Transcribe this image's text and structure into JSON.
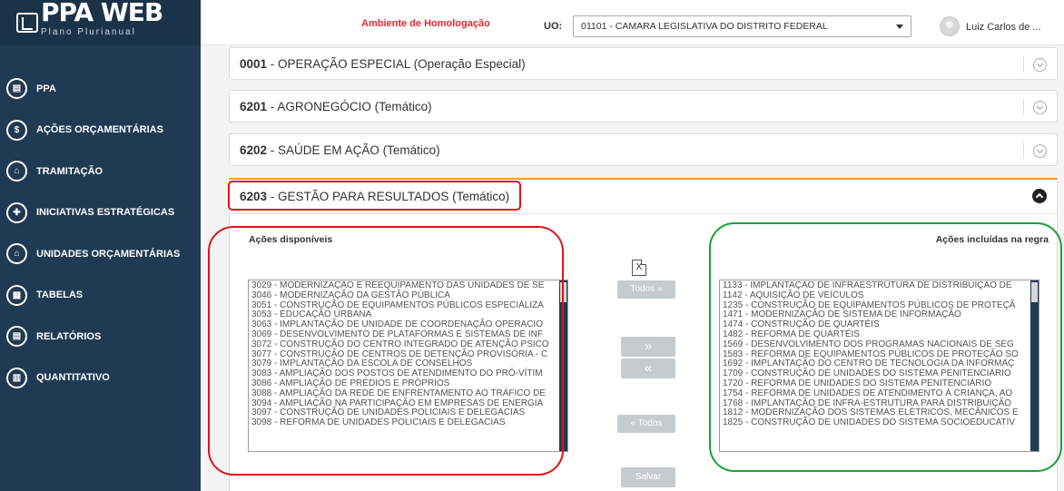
{
  "app": {
    "logo_title": "PPA WEB",
    "logo_subtitle": "Plano Plurianual"
  },
  "header": {
    "environment": "Ambiente de Homologação",
    "uo_label": "UO:",
    "uo_value": "01101 - CAMARA LEGISLATIVA DO DISTRITO FEDERAL",
    "user": "Luiz Carlos de ..."
  },
  "sidebar": {
    "items": [
      {
        "label": "PPA",
        "icon": "book-icon",
        "glyph": "▤"
      },
      {
        "label": "AÇÕES ORÇAMENTÁRIAS",
        "icon": "dollar-icon",
        "glyph": "$"
      },
      {
        "label": "TRAMITAÇÃO",
        "icon": "inbox-icon",
        "glyph": "⌂"
      },
      {
        "label": "INICIATIVAS ESTRATÉGICAS",
        "icon": "puzzle-icon",
        "glyph": "✚"
      },
      {
        "label": "UNIDADES ORÇAMENTÁRIAS",
        "icon": "bank-icon",
        "glyph": "⌂"
      },
      {
        "label": "TABELAS",
        "icon": "table-icon",
        "glyph": "▦"
      },
      {
        "label": "RELATÓRIOS",
        "icon": "document-icon",
        "glyph": "▤"
      },
      {
        "label": "QUANTITATIVO",
        "icon": "bar-chart-icon",
        "glyph": "▥"
      }
    ]
  },
  "programs": [
    {
      "code": "0001",
      "title": "OPERAÇÃO ESPECIAL (Operação Especial)"
    },
    {
      "code": "6201",
      "title": "AGRONEGÓCIO (Temático)"
    },
    {
      "code": "6202",
      "title": "SAÚDE EM AÇÃO (Temático)"
    },
    {
      "code": "6203",
      "title": "GESTÃO PARA RESULTADOS (Temático)"
    }
  ],
  "available": {
    "title": "Ações disponíveis",
    "items": [
      "3029 - MODERNIZAÇÃO E REEQUIPAMENTO DAS UNIDADES DE SE",
      "3046 - MODERNIZAÇÃO DA GESTÃO PÚBLICA",
      "3051 - CONSTRUÇÃO DE EQUIPAMENTOS PÚBLICOS ESPECIALIZA",
      "3053 - EDUCAÇÃO URBANA",
      "3063 - IMPLANTAÇÃO DE UNIDADE DE COORDENAÇÃO OPERACIO",
      "3069 - DESENVOLVIMENTO DE PLATAFORMAS E SISTEMAS DE INF",
      "3072 - CONSTRUÇÃO DO CENTRO INTEGRADO DE ATENÇÃO PSICO",
      "3077 - CONSTRUÇÃO DE CENTROS DE DETENÇÃO PROVISÓRIA - C",
      "3079 - IMPLANTAÇÃO DA ESCOLA DE CONSELHOS",
      "3083 - AMPLIAÇÃO DOS POSTOS DE ATENDIMENTO DO PRÓ-VÍTIM",
      "3086 - AMPLIAÇÃO DE PRÉDIOS E PRÓPRIOS",
      "3088 - AMPLIAÇÃO DA REDE DE ENFRENTAMENTO AO TRÁFICO DE",
      "3094 - AMPLIAÇÃO NA PARTICIPAÇÃO EM EMPRESAS DE ENERGIA",
      "3097 - CONSTRUÇÃO DE UNIDADES POLICIAIS E DELEGACIAS",
      "3098 - REFORMA DE UNIDADES POLICIAIS E DELEGACIAS"
    ]
  },
  "included": {
    "title": "Ações incluídas na regra",
    "items": [
      "1133 - IMPLANTAÇÃO DE INFRAESTRUTURA DE DISTRIBUIÇÃO DE",
      "1142 - AQUISIÇÃO DE VEÍCULOS",
      "1235 - CONSTRUÇÃO DE EQUIPAMENTOS PÚBLICOS DE PROTEÇÃ",
      "1471 - MODERNIZAÇÃO DE SISTEMA DE INFORMAÇÃO",
      "1474 - CONSTRUÇÃO DE QUARTÉIS",
      "1482 - REFORMA DE QUARTÉIS",
      "1569 - DESENVOLVIMENTO DOS PROGRAMAS NACIONAIS DE SEG",
      "1583 - REFORMA DE EQUIPAMENTOS PÚBLICOS DE PROTEÇÃO SO",
      "1692 - IMPLANTAÇÃO DO CENTRO DE TECNOLOGIA DA INFORMAÇ",
      "1709 - CONSTRUÇÃO DE UNIDADES DO SISTEMA PENITENCIÁRIO",
      "1720 - REFORMA DE UNIDADES DO SISTEMA PENITENCIÁRIO",
      "1754 - REFORMA DE UNIDADES DE ATENDIMENTO À CRIANÇA, AO",
      "1768 - IMPLANTAÇÃO DE INFRA-ESTRUTURA PARA DISTRIBUIÇÃO",
      "1812 - MODERNIZAÇÃO DOS SISTEMAS ELÉTRICOS, MECÂNICOS E",
      "1825 - CONSTRUÇÃO DE UNIDADES DO SISTEMA SOCIOEDUCATIV"
    ]
  },
  "controls": {
    "export_icon_label": "X",
    "all_right": "Todos »",
    "move_right": "»",
    "move_left": "«",
    "all_left": "« Todos",
    "save": "Salvar"
  },
  "colors": {
    "sidebar": "#1f3a52",
    "environment_text": "#e0292e",
    "open_panel_accent": "#e2a42f",
    "highlight_red": "#e0121b",
    "highlight_green": "#1ba23a"
  }
}
